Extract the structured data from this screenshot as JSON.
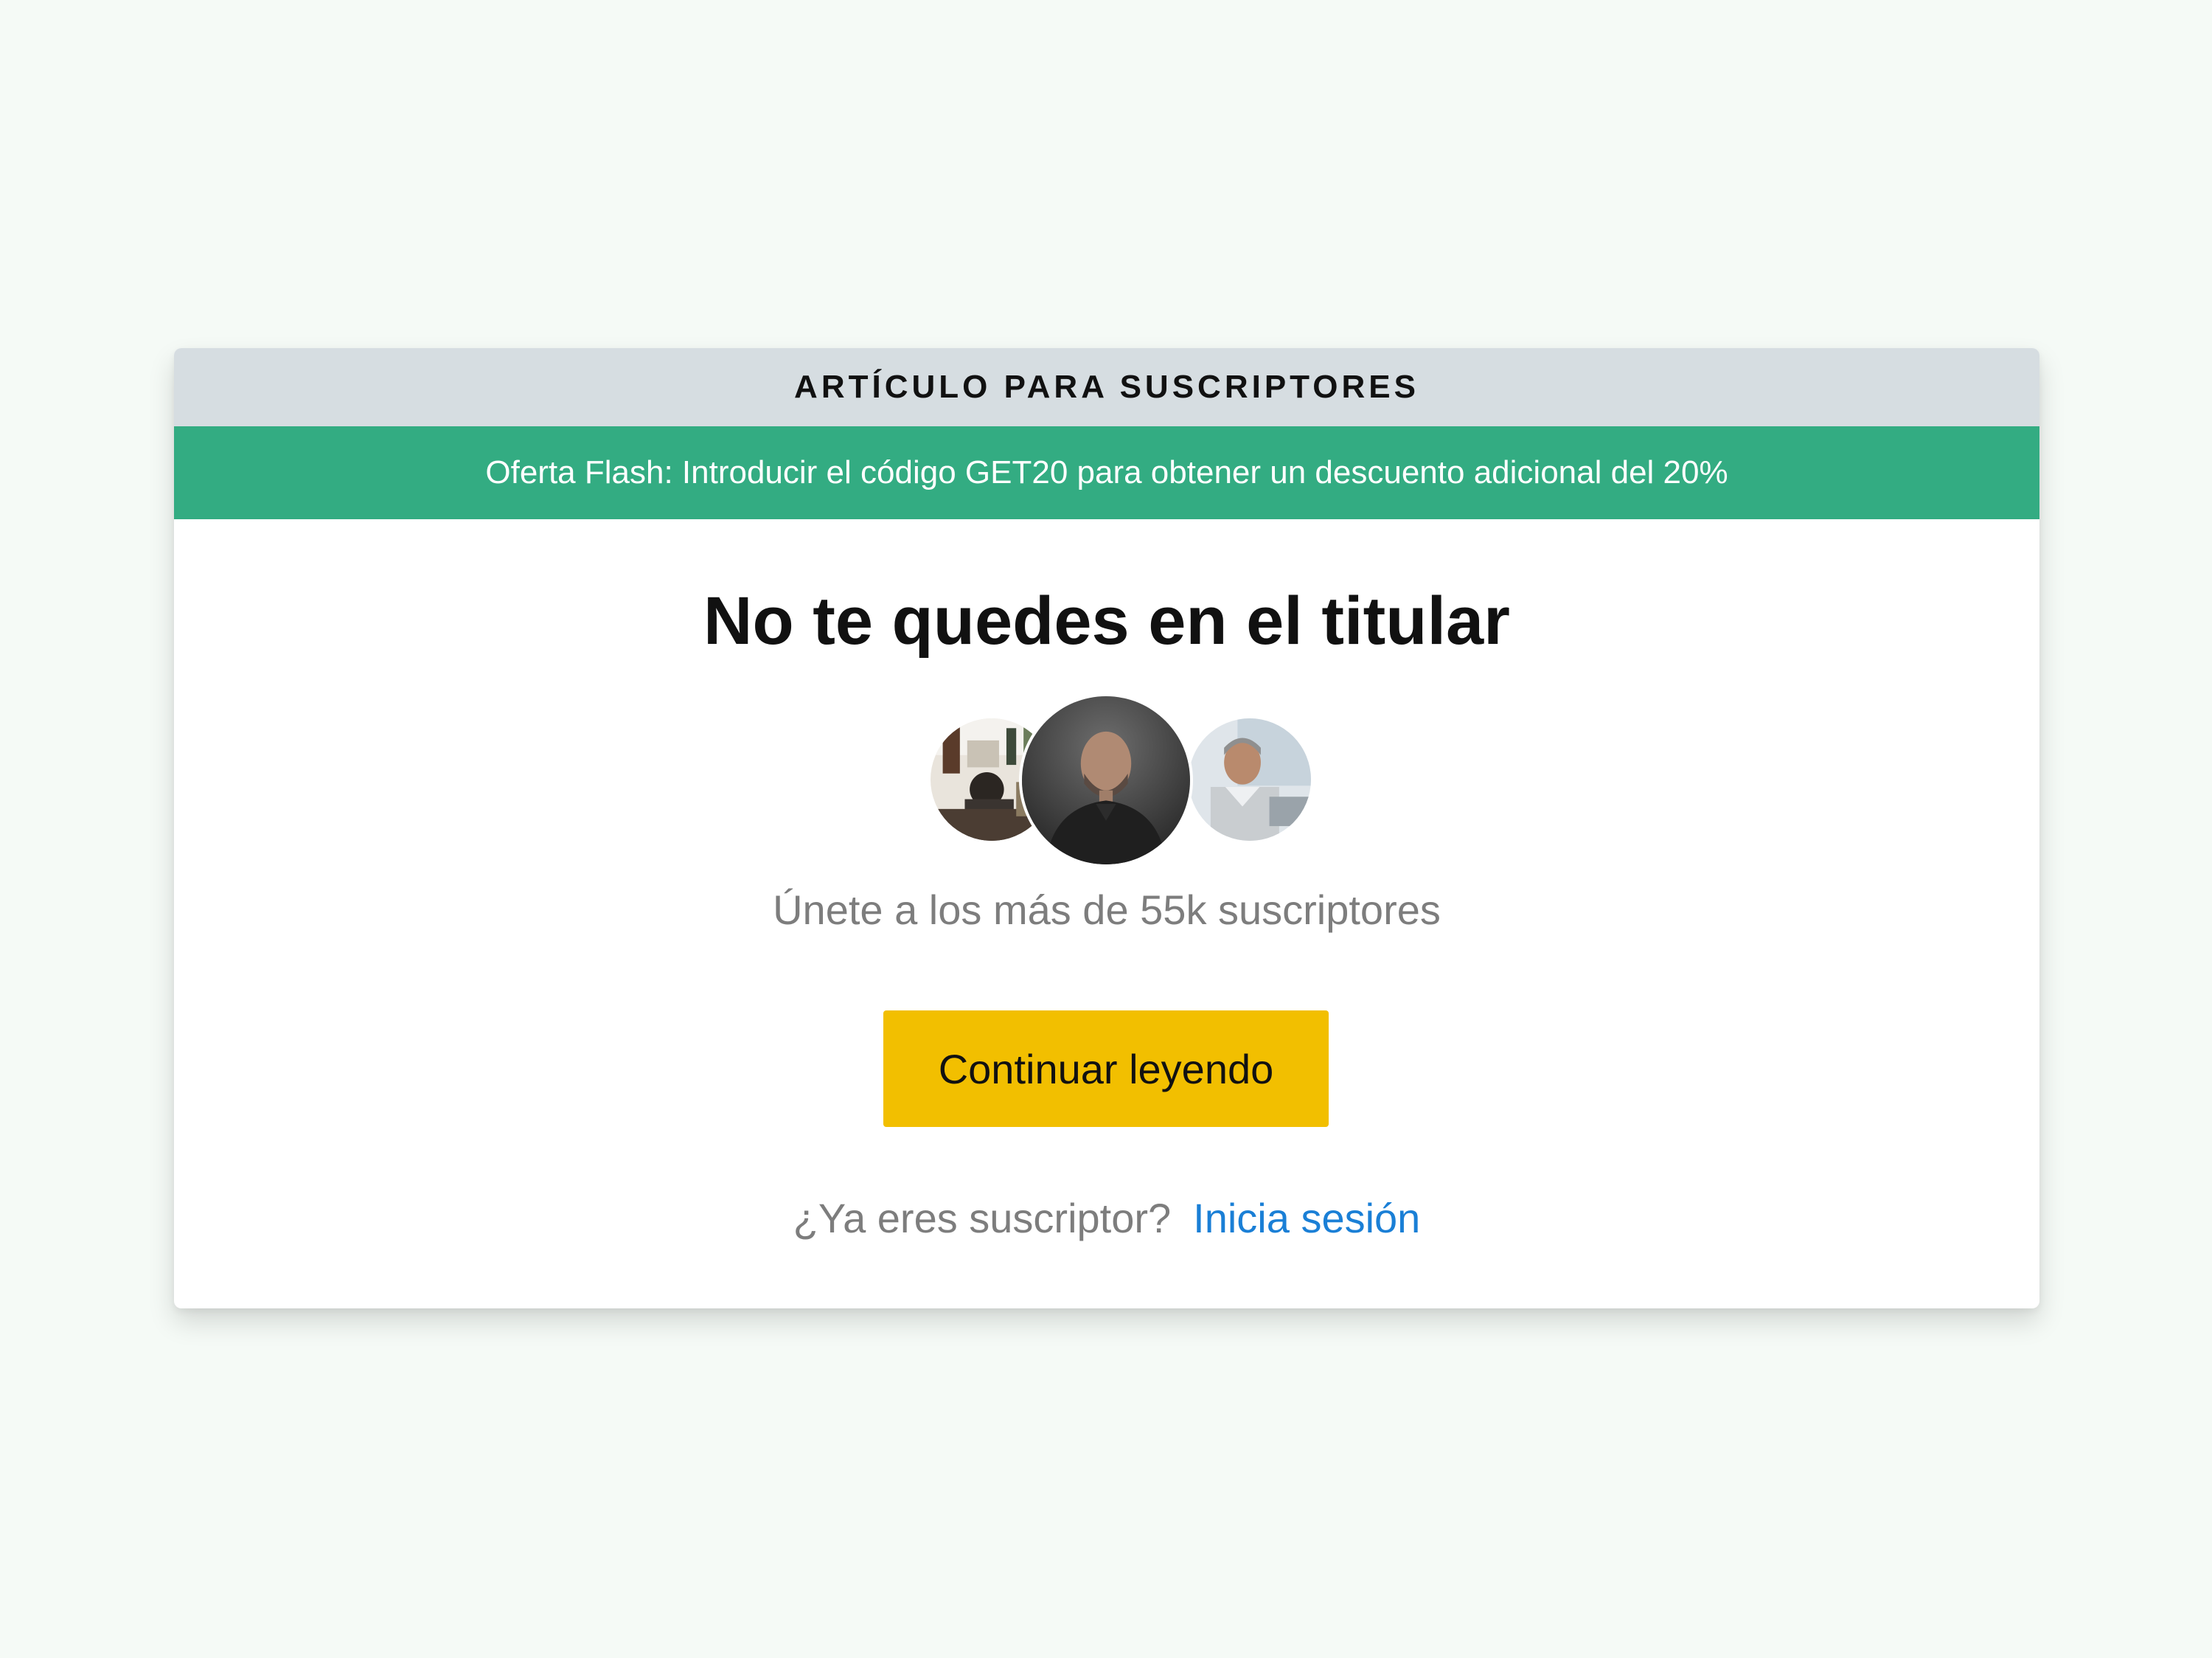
{
  "paywall": {
    "header": "ARTÍCULO PARA SUSCRIPTORES",
    "promo": "Oferta Flash: Introducir el código GET20 para obtener un descuento adicional del 20%",
    "headline": "No te quedes en el titular",
    "avatars": [
      "cafe-readers-photo",
      "bearded-man-portrait",
      "smiling-man-laptop-photo"
    ],
    "subscribers_text": "Únete a los más de 55k suscriptores",
    "cta_label": "Continuar leyendo",
    "signin_question": "¿Ya eres suscriptor?",
    "signin_link": "Inicia sesión"
  },
  "colors": {
    "page_background": "#f5faf6",
    "header_background": "#d6dde1",
    "promo_background": "#33ac82",
    "cta_background": "#f2bf00",
    "link": "#1a7fd6",
    "muted_text": "#7d7d7d"
  }
}
